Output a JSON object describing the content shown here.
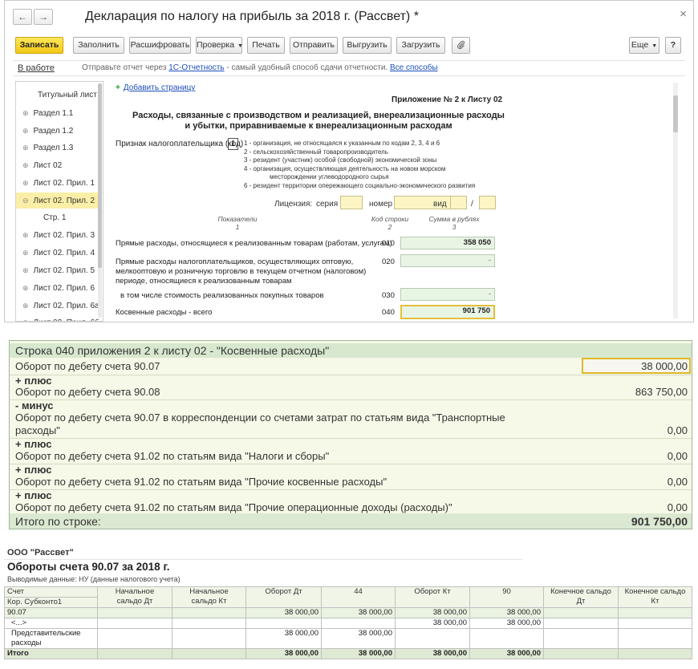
{
  "window": {
    "title": "Декларация по налогу на прибыль за 2018 г. (Рассвет) *",
    "back_icon": "←",
    "forward_icon": "→",
    "close_icon": "×"
  },
  "toolbar": {
    "record": "Записать",
    "fill": "Заполнить",
    "decode": "Расшифровать",
    "check": "Проверка",
    "print": "Печать",
    "send": "Отправить",
    "export": "Выгрузить",
    "import": "Загрузить",
    "attach_icon": "paperclip",
    "more": "Еще",
    "help": "?"
  },
  "infobar": {
    "status": "В работе",
    "text_before": "Отправьте отчет через",
    "link1": "1С-Отчетность",
    "text_middle": "- самый удобный способ сдачи отчетности.",
    "link2": "Все способы"
  },
  "sidebar": {
    "items": [
      {
        "label": "Титульный лист",
        "expander": ""
      },
      {
        "label": "Раздел 1.1",
        "expander": "⊕"
      },
      {
        "label": "Раздел 1.2",
        "expander": "⊕"
      },
      {
        "label": "Раздел 1.3",
        "expander": "⊕"
      },
      {
        "label": "Лист 02",
        "expander": "⊕"
      },
      {
        "label": "Лист 02. Прил. 1",
        "expander": "⊕"
      },
      {
        "label": "Лист 02. Прил. 2",
        "expander": "⊖"
      },
      {
        "label": "Стр. 1",
        "expander": ""
      },
      {
        "label": "Лист 02. Прил. 3",
        "expander": "⊕"
      },
      {
        "label": "Лист 02. Прил. 4",
        "expander": "⊕"
      },
      {
        "label": "Лист 02. Прил. 5",
        "expander": "⊕"
      },
      {
        "label": "Лист 02. Прил. 6",
        "expander": "⊕"
      },
      {
        "label": "Лист 02. Прил. 6а",
        "expander": "⊕"
      },
      {
        "label": "Лист 02. Прил. 6б",
        "expander": "⊕"
      }
    ]
  },
  "form": {
    "add_page": "Добавить страницу",
    "appendix_title": "Приложение № 2 к Листу 02",
    "heading_line1": "Расходы, связанные с производством и реализацией, внереализационные расходы",
    "heading_line2": "и убытки, приравниваемые к внереализационным расходам",
    "sign_label": "Признак налогоплательщика (код)",
    "sign_value": "1",
    "code_lines": [
      "1 - организация, не относящаяся к указанным по кодам 2, 3, 4 и 6",
      "2 - сельскохозяйственный товаропроизводитель",
      "3 - резидент (участник) особой (свободной) экономической зоны",
      "4 - организация, осуществляющая деятельность на новом морском",
      "месторождении углеводородного сырья",
      "6 - резидент территории опережающего социально-экономического развития"
    ],
    "license_label": "Лицензия:",
    "series_label": "серия",
    "number_label": "номер",
    "kind_label": "вид",
    "slash": "/",
    "col1_name": "Показатели",
    "col1_num": "1",
    "col2_name": "Код строки",
    "col2_num": "2",
    "col3_name": "Сумма в рублях",
    "col3_num": "3",
    "rows": [
      {
        "label": "Прямые расходы, относящиеся к реализованным товарам (работам, услугам)",
        "code": "010",
        "value": "358 050"
      },
      {
        "label_lines": [
          "Прямые расходы налогоплательщиков, осуществляющих оптовую,",
          "мелкооптовую и розничную торговлю в текущем отчетном (налоговом)",
          "периоде, относящиеся к реализованным товарам"
        ],
        "code": "020",
        "value": "-"
      },
      {
        "label": "в том числе стоимость реализованных покупных товаров",
        "code": "030",
        "value": "-"
      },
      {
        "label": "Косвенные расходы - всего",
        "code": "040",
        "value": "901 750"
      }
    ]
  },
  "decoding": {
    "title": "Строка 040 приложения 2 к листу 02 - \"Косвенные расходы\"",
    "items": [
      {
        "op": "",
        "label": "Оборот по дебету счета 90.07",
        "value": "38 000,00"
      },
      {
        "op": "+ плюс",
        "label": "Оборот по дебету счета 90.08",
        "value": "863 750,00"
      },
      {
        "op": "- минус",
        "label": "Оборот по дебету счета 90.07 в корреспонденции со счетами затрат по статьям вида \"Транспортные",
        "label2": "расходы\"",
        "value": "0,00"
      },
      {
        "op": "+ плюс",
        "label": "Оборот по дебету счета 91.02 по статьям вида \"Налоги и сборы\"",
        "value": "0,00"
      },
      {
        "op": "+ плюс",
        "label": "Оборот по дебету счета 91.02 по статьям вида \"Прочие косвенные расходы\"",
        "value": "0,00"
      },
      {
        "op": "+ плюс",
        "label": "Оборот по дебету счета 91.02 по статьям вида \"Прочие операционные доходы (расходы)\"",
        "value": "0,00"
      }
    ],
    "total_label": "Итого по строке:",
    "total_value": "901 750,00"
  },
  "report": {
    "org": "ООО \"Рассвет\"",
    "title": "Обороты счета 90.07 за 2018 г.",
    "subtitle": "Выводимые данные:  НУ (данные налогового учета)",
    "headers": {
      "account": "Счет",
      "subconto": "Кор. Субконто1",
      "open_dt_1": "Начальное",
      "open_dt_2": "сальдо Дт",
      "open_kt_1": "Начальное",
      "open_kt_2": "сальдо Кт",
      "turn_dt": "Оборот Дт",
      "acc44": "44",
      "turn_kt": "Оборот Кт",
      "acc90": "90",
      "close_dt_1": "Конечное сальдо",
      "close_dt_2": "Дт",
      "close_kt_1": "Конечное сальдо",
      "close_kt_2": "Кт"
    },
    "rows": [
      {
        "name": "90.07",
        "name2": "",
        "turn_dt": "38 000,00",
        "acc44": "38 000,00",
        "turn_kt": "38 000,00",
        "acc90": "38 000,00"
      },
      {
        "name": "<...>",
        "name2": "",
        "turn_dt": "",
        "acc44": "",
        "turn_kt": "38 000,00",
        "acc90": "38 000,00"
      },
      {
        "name": "Представительские",
        "name2": "расходы",
        "turn_dt": "38 000,00",
        "acc44": "38 000,00",
        "turn_kt": "",
        "acc90": ""
      }
    ],
    "total": {
      "name": "Итого",
      "turn_dt": "38 000,00",
      "acc44": "38 000,00",
      "turn_kt": "38 000,00",
      "acc90": "38 000,00"
    }
  }
}
